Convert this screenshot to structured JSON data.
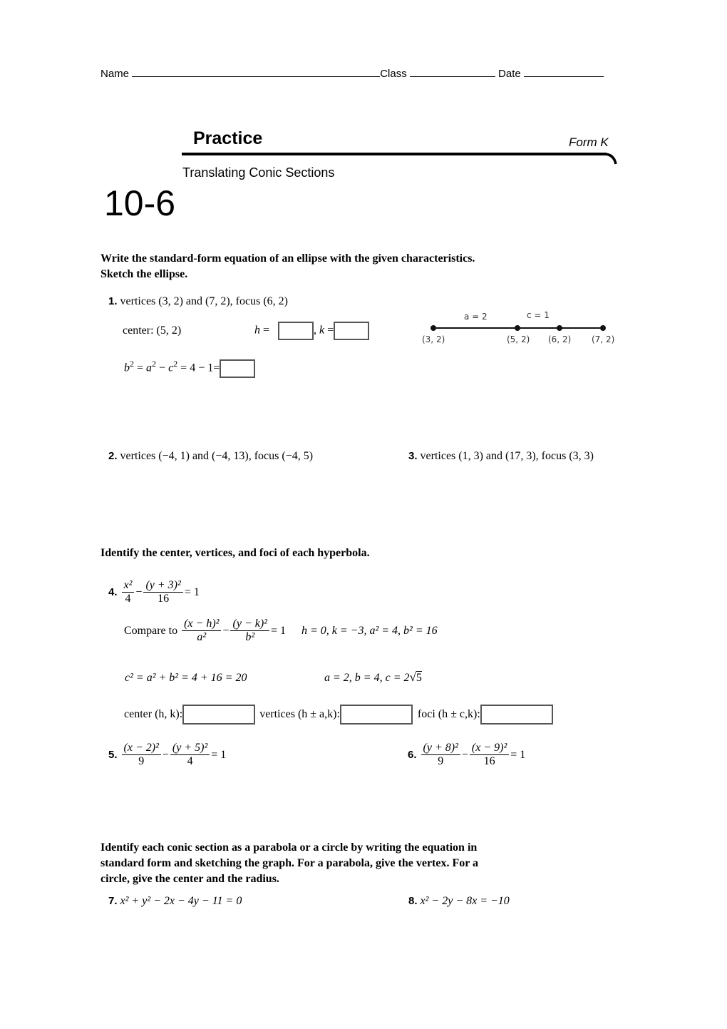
{
  "header": {
    "name_label": "Name",
    "class_label": "Class",
    "date_label": "Date"
  },
  "banner": {
    "title": "Practice",
    "form": "Form K",
    "subtitle": "Translating Conic Sections",
    "lesson_number": "10-6"
  },
  "section1": {
    "instructions_line1": "Write the standard-form equation of an ellipse with the given characteristics.",
    "instructions_line2": "Sketch the ellipse.",
    "problem1": {
      "number": "1.",
      "text": "vertices (3, 2) and (7, 2), focus (6, 2)",
      "center_text": "center: (5, 2)",
      "h_label": "h",
      "k_label": "k",
      "equals": "=",
      "b2_equation": {
        "b": "b",
        "a": "a",
        "c": "c",
        "exp": "2",
        "rest": "= 4 − 1="
      },
      "diagram": {
        "a_label": "a = 2",
        "c_label": "c = 1",
        "points": [
          "(3, 2)",
          "(5, 2)",
          "(6, 2)",
          "(7, 2)"
        ]
      }
    },
    "problem2": {
      "number": "2.",
      "text": "vertices (−4, 1) and (−4, 13), focus (−4, 5)"
    },
    "problem3": {
      "number": "3.",
      "text": "vertices (1, 3) and (17, 3), focus (3, 3)"
    }
  },
  "section2": {
    "instructions": "Identify the center, vertices, and foci of each hyperbola.",
    "problem4": {
      "number": "4.",
      "frac1_num": "x²",
      "frac1_den": "4",
      "frac2_num": "(y + 3)²",
      "frac2_den": "16",
      "rhs": "= 1",
      "compare_label": "Compare to",
      "cmp_frac1_num": "(x − h)²",
      "cmp_frac1_den": "a²",
      "cmp_frac2_num": "(y − k)²",
      "cmp_frac2_den": "b²",
      "cmp_rhs": "= 1",
      "values": "h = 0, k = −3, a² = 4, b² = 16",
      "c2_line": "c² = a² + b² = 4 + 16 = 20",
      "abc_line_prefix": "a = 2, b = 4, c = 2",
      "sqrt_value": "5",
      "center_label": "center (h, k):",
      "vertices_label": "vertices (h ± a,k):",
      "foci_label": "foci (h ± c,k):"
    },
    "problem5": {
      "number": "5.",
      "frac1_num": "(x − 2)²",
      "frac1_den": "9",
      "frac2_num": "(y + 5)²",
      "frac2_den": "4",
      "rhs": "= 1"
    },
    "problem6": {
      "number": "6.",
      "frac1_num": "(y + 8)²",
      "frac1_den": "9",
      "frac2_num": "(x − 9)²",
      "frac2_den": "16",
      "rhs": "= 1"
    },
    "minus": "−"
  },
  "section3": {
    "instructions_line1": "Identify each conic section as a parabola or a circle by writing the equation in",
    "instructions_line2": "standard form and sketching the graph. For a parabola, give the vertex. For a",
    "instructions_line3": "circle, give the center and the radius.",
    "problem7": {
      "number": "7.",
      "equation": "x² + y²  − 2x − 4y − 11 = 0"
    },
    "problem8": {
      "number": "8.",
      "equation": "x² − 2y − 8x = −10"
    }
  }
}
